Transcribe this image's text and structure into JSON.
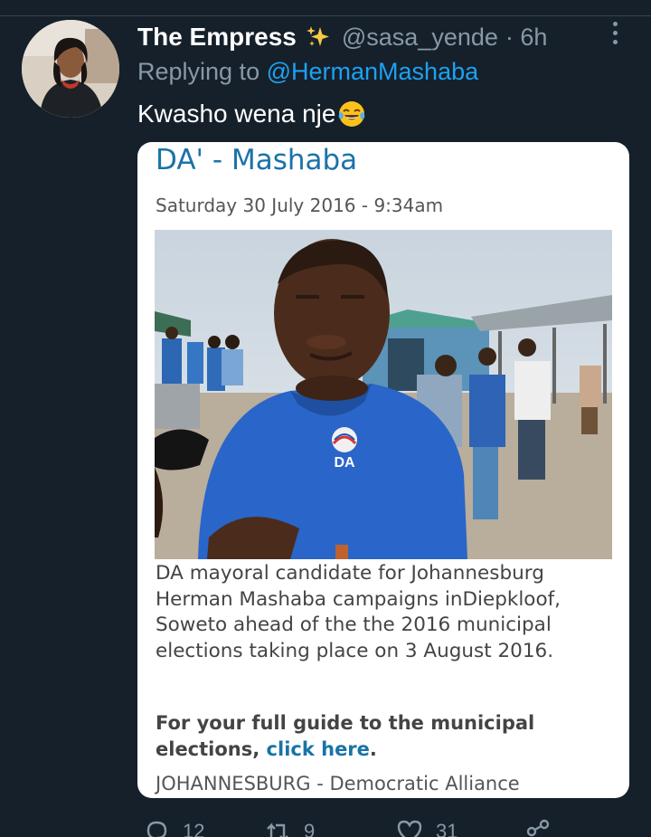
{
  "tweet": {
    "display_name": "The Empress",
    "handle": "@sasa_yende",
    "time": "· 6h",
    "replying_prefix": "Replying to",
    "replying_to": "@HermanMashaba",
    "text": "Kwasho wena nje",
    "emoji_icon": "face-with-tears-of-joy-icon",
    "badge_icon": "sparkles-icon"
  },
  "card": {
    "title": "DA' - Mashaba",
    "date": "Saturday 30 July 2016 - 9:34am",
    "caption": "DA mayoral candidate for Johannesburg Herman Mashaba campaigns inDiepkloof, Soweto ahead of the the 2016 municipal elections taking place on 3 August 2016.",
    "guide_text": "For your full guide to the municipal elections,",
    "guide_link": "click here",
    "guide_end": ".",
    "source_line": "JOHANNESBURG - Democratic Alliance",
    "shirt_logo_text": "DA"
  },
  "actions": {
    "reply_count": "12",
    "retweet_count": "9",
    "like_count": "31"
  },
  "colors": {
    "background": "#15202b",
    "accent": "#1da1f2",
    "muted": "#8899a6",
    "card_link": "#1a73a8"
  }
}
